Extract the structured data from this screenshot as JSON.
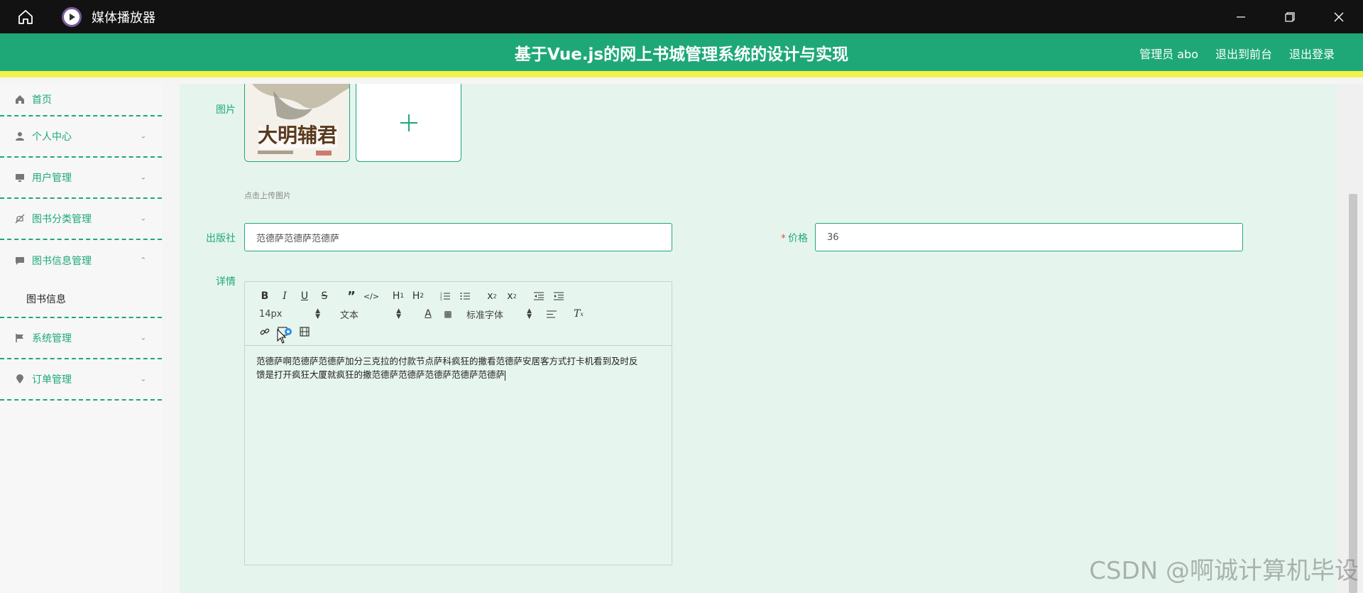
{
  "window": {
    "title": "媒体播放器"
  },
  "header": {
    "title": "基于Vue.js的网上书城管理系统的设计与实现",
    "user": "管理员 abo",
    "back_front": "退出到前台",
    "logout": "退出登录"
  },
  "sidebar": {
    "items": [
      {
        "label": "首页",
        "icon": "home-icon"
      },
      {
        "label": "个人中心",
        "icon": "user-icon"
      },
      {
        "label": "用户管理",
        "icon": "monitor-icon"
      },
      {
        "label": "图书分类管理",
        "icon": "bell-off-icon"
      },
      {
        "label": "图书信息管理",
        "icon": "chat-icon",
        "sub": [
          "图书信息"
        ]
      },
      {
        "label": "系统管理",
        "icon": "flag-icon"
      },
      {
        "label": "订单管理",
        "icon": "location-icon"
      }
    ]
  },
  "form": {
    "image_label": "图片",
    "upload_hint": "点击上传图片",
    "thumb_title": "大明辅君",
    "publisher_label": "出版社",
    "publisher_value": "范德萨范德萨范德萨",
    "price_label": "价格",
    "price_required": "*",
    "price_value": "36",
    "detail_label": "详情"
  },
  "editor": {
    "font_size": "14px",
    "block_type": "文本",
    "font_family": "标准字体",
    "content_line1": "范德萨啊范德萨范德萨加分三克拉的付款节点萨科疯狂的撒看范德萨安居客方式打卡机看到及时反",
    "content_line2": "馈是打开疯狂大厦就疯狂的撒范德萨范德萨范德萨范德萨范德萨"
  },
  "watermark": "CSDN @啊诚计算机毕设",
  "colors": {
    "primary": "#1ea878",
    "accent_bar": "#f1f24a",
    "main_bg": "#e5f5ee"
  }
}
